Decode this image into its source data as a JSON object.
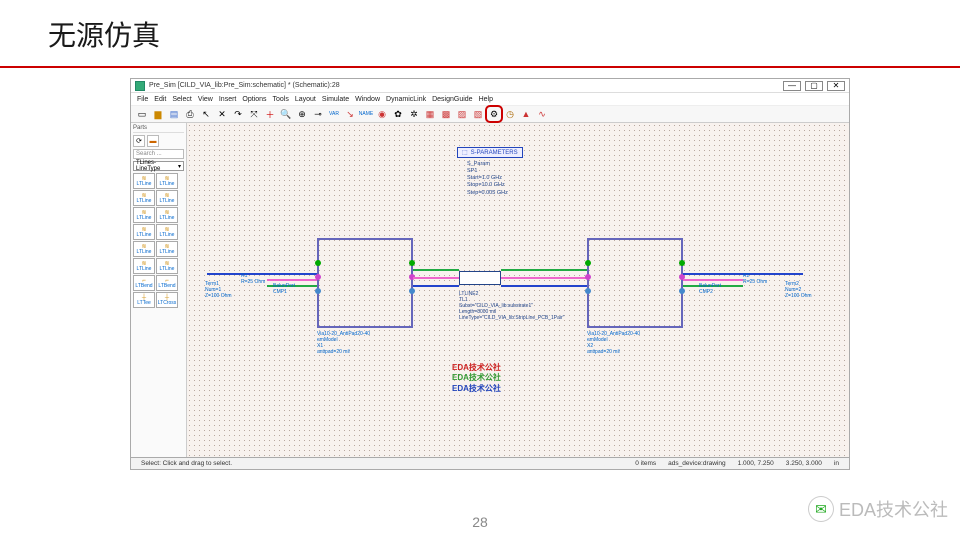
{
  "slide": {
    "title": "无源仿真",
    "page_number": "28"
  },
  "titlebar": {
    "text": "Pre_Sim [CILD_VIA_lib:Pre_Sim:schematic] * (Schematic):28"
  },
  "win_buttons": {
    "min": "—",
    "max": "▢",
    "close": "✕"
  },
  "menus": [
    "File",
    "Edit",
    "Select",
    "View",
    "Insert",
    "Options",
    "Tools",
    "Layout",
    "Simulate",
    "Window",
    "DynamicLink",
    "DesignGuide",
    "Help"
  ],
  "toolbar_icons": [
    "file-new",
    "folder-open",
    "save",
    "print",
    "sep",
    "cursor",
    "undo",
    "redo",
    "zoom-fit",
    "sep",
    "plus",
    "zoom",
    "zoom-in",
    "sep",
    "key",
    "var",
    "wire",
    "name",
    "sep",
    "globe",
    "gear",
    "cog",
    "sep",
    "grid",
    "grid2",
    "grid3",
    "grid4",
    "sep",
    "sim-gear",
    "clock",
    "poly",
    "wave"
  ],
  "highlighted_tool": "sim-gear",
  "left_panel": {
    "header": "Parts",
    "search_placeholder": "Search ...",
    "dropdown": "TLines-LineType",
    "items": [
      [
        "LTLine",
        "LTLine"
      ],
      [
        "LTLine",
        "LTLine"
      ],
      [
        "LTLine",
        "LTLine"
      ],
      [
        "LTLine",
        "LTLine"
      ],
      [
        "LTLine",
        "LTLine"
      ],
      [
        "LTLine",
        "LTLine"
      ],
      [
        "LTBend",
        "LTBend"
      ],
      [
        "LTTee",
        "LTCross"
      ]
    ]
  },
  "sparam": {
    "label": "S-PARAMETERS",
    "lines": [
      "S_Param",
      "SP1",
      "Start=1.0 GHz",
      "Stop=10.0 GHz",
      "Step=0.005 GHz"
    ]
  },
  "block1": {
    "name": "Via10-20_AntiPad20-40",
    "model": "emModel",
    "inst": "X1",
    "param": "antipad=20 mil"
  },
  "block2": {
    "name": "Via10-20_AntiPad20-40",
    "model": "emModel",
    "inst": "X2",
    "param": "antipad=20 mil"
  },
  "tline": {
    "name": "LTLINE2",
    "inst": "TL1",
    "l1": "Subst=\"CILD_VIA_lib:substrate1\"",
    "l2": "Length=8000 mil",
    "l3": "LineType=\"CILD_VIA_lib:StripLine_PCB_1Pair\""
  },
  "term1": {
    "name": "Term1",
    "l1": "Num=1",
    "l2": "Z=100 Ohm"
  },
  "term2": {
    "name": "Term2",
    "l1": "Num=2",
    "l2": "Z=100 Ohm"
  },
  "r1": {
    "name": "R1",
    "val": "R=25 Ohm"
  },
  "r2": {
    "name": "R2",
    "val": "R=25 Ohm"
  },
  "cmp1": {
    "name": "BalunPort",
    "inst": "CMP1"
  },
  "cmp2": {
    "name": "BalunPort",
    "inst": "CMP2"
  },
  "watermark": [
    "EDA技术公社",
    "EDA技术公社",
    "EDA技术公社"
  ],
  "statusbar": {
    "hint": "Select: Click and drag to select.",
    "items": "0 items",
    "layer": "ads_device:drawing",
    "coord1": "1.000, 7.250",
    "coord2": "3.250, 3.000",
    "unit": "in"
  },
  "corner": {
    "label": "EDA技术公社"
  }
}
